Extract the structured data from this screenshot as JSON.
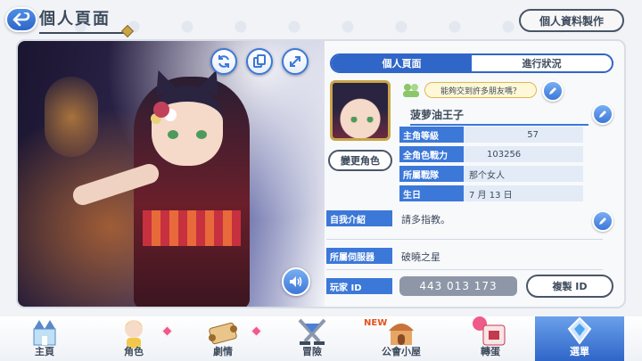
{
  "header": {
    "title": "個人頁面",
    "make_profile_label": "個人資料製作"
  },
  "tabs": [
    {
      "label": "個人頁面",
      "active": true
    },
    {
      "label": "進行狀況",
      "active": false
    }
  ],
  "profile": {
    "friend_bubble": "能夠交到許多朋友嗎？",
    "player_name": "菠萝油王子",
    "change_character_label": "變更角色",
    "stats": [
      {
        "label": "主角等級",
        "value": "57"
      },
      {
        "label": "全角色戰力",
        "value": "103256"
      },
      {
        "label": "所屬戰隊",
        "value": "那个女人"
      },
      {
        "label": "生日",
        "value": "7 月 13 日"
      }
    ],
    "intro_label": "自我介紹",
    "intro_value": "請多指教。",
    "server_label": "所屬伺服器",
    "server_value": "破曉之星",
    "player_id_label": "玩家 ID",
    "player_id_value": "443 013 173",
    "copy_id_label": "複製 ID"
  },
  "nav": {
    "items": [
      {
        "label": "主頁",
        "icon": "castle-icon",
        "active": false
      },
      {
        "label": "角色",
        "icon": "character-icon",
        "active": false,
        "notification": true
      },
      {
        "label": "劇情",
        "icon": "scroll-icon",
        "active": false,
        "notification": true
      },
      {
        "label": "冒險",
        "icon": "swords-icon",
        "active": false
      },
      {
        "label": "公會小屋",
        "icon": "guild-house-icon",
        "active": false,
        "badge": "NEW"
      },
      {
        "label": "轉蛋",
        "icon": "gacha-icon",
        "active": false
      },
      {
        "label": "選單",
        "icon": "menu-gem-icon",
        "active": true
      }
    ]
  },
  "colors": {
    "accent": "#3c78d8",
    "text": "#3d4a5c",
    "notification": "#f05a8a"
  }
}
